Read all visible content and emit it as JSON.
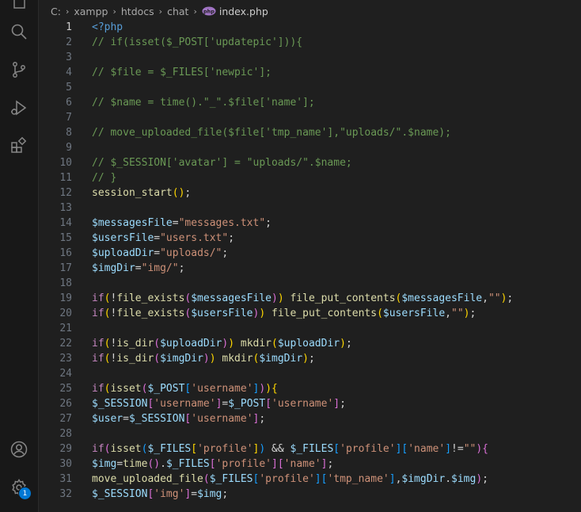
{
  "breadcrumb": {
    "items": [
      "C:",
      "xampp",
      "htdocs",
      "chat"
    ],
    "file": "index.php"
  },
  "activity": {
    "icons": [
      "files-icon",
      "search-icon",
      "source-control-icon",
      "run-debug-icon",
      "extensions-icon",
      "account-icon",
      "settings-gear-icon"
    ],
    "settings_badge": "1"
  },
  "colors": {
    "background": "#1f1f1f",
    "activity_bar": "#181818",
    "comment": "#6a9955",
    "keyword_tag": "#569cd6",
    "function": "#dcdcaa",
    "variable": "#9cdcfe",
    "string": "#ce9178",
    "badge": "#0078d4"
  },
  "editor": {
    "active_line": 1,
    "lines": [
      {
        "n": "1",
        "code": [
          [
            "t-tag",
            "<?php"
          ]
        ]
      },
      {
        "n": "2",
        "code": [
          [
            "t-com",
            "// if(isset($_POST['updatepic'])){"
          ]
        ]
      },
      {
        "n": "3",
        "code": []
      },
      {
        "n": "4",
        "code": [
          [
            "t-com",
            "// $file = $_FILES['newpic'];"
          ]
        ]
      },
      {
        "n": "5",
        "code": []
      },
      {
        "n": "6",
        "code": [
          [
            "t-com",
            "// $name = time().\"_\".$file['name'];"
          ]
        ]
      },
      {
        "n": "7",
        "code": []
      },
      {
        "n": "8",
        "code": [
          [
            "t-com",
            "// move_uploaded_file($file['tmp_name'],\"uploads/\".$name);"
          ]
        ]
      },
      {
        "n": "9",
        "code": []
      },
      {
        "n": "10",
        "code": [
          [
            "t-com",
            "// $_SESSION['avatar'] = \"uploads/\".$name;"
          ]
        ]
      },
      {
        "n": "11",
        "code": [
          [
            "t-com",
            "// }"
          ]
        ]
      },
      {
        "n": "12",
        "code": [
          [
            "t-fn",
            "session_start"
          ],
          [
            "t-p1",
            "()"
          ],
          [
            "t-op",
            ";"
          ]
        ]
      },
      {
        "n": "13",
        "code": []
      },
      {
        "n": "14",
        "code": [
          [
            "t-var",
            "$messagesFile"
          ],
          [
            "t-op",
            "="
          ],
          [
            "t-str",
            "\"messages.txt\""
          ],
          [
            "t-op",
            ";"
          ]
        ]
      },
      {
        "n": "15",
        "code": [
          [
            "t-var",
            "$usersFile"
          ],
          [
            "t-op",
            "="
          ],
          [
            "t-str",
            "\"users.txt\""
          ],
          [
            "t-op",
            ";"
          ]
        ]
      },
      {
        "n": "16",
        "code": [
          [
            "t-var",
            "$uploadDir"
          ],
          [
            "t-op",
            "="
          ],
          [
            "t-str",
            "\"uploads/\""
          ],
          [
            "t-op",
            ";"
          ]
        ]
      },
      {
        "n": "17",
        "code": [
          [
            "t-var",
            "$imgDir"
          ],
          [
            "t-op",
            "="
          ],
          [
            "t-str",
            "\"img/\""
          ],
          [
            "t-op",
            ";"
          ]
        ]
      },
      {
        "n": "18",
        "code": []
      },
      {
        "n": "19",
        "code": [
          [
            "t-kw",
            "if"
          ],
          [
            "t-p1",
            "("
          ],
          [
            "t-op",
            "!"
          ],
          [
            "t-fn",
            "file_exists"
          ],
          [
            "t-p2",
            "("
          ],
          [
            "t-var",
            "$messagesFile"
          ],
          [
            "t-p2",
            ")"
          ],
          [
            "t-p1",
            ")"
          ],
          [
            "t-op",
            " "
          ],
          [
            "t-fn",
            "file_put_contents"
          ],
          [
            "t-p1",
            "("
          ],
          [
            "t-var",
            "$messagesFile"
          ],
          [
            "t-op",
            ","
          ],
          [
            "t-str",
            "\"\""
          ],
          [
            "t-p1",
            ")"
          ],
          [
            "t-op",
            ";"
          ]
        ]
      },
      {
        "n": "20",
        "code": [
          [
            "t-kw",
            "if"
          ],
          [
            "t-p1",
            "("
          ],
          [
            "t-op",
            "!"
          ],
          [
            "t-fn",
            "file_exists"
          ],
          [
            "t-p2",
            "("
          ],
          [
            "t-var",
            "$usersFile"
          ],
          [
            "t-p2",
            ")"
          ],
          [
            "t-p1",
            ")"
          ],
          [
            "t-op",
            " "
          ],
          [
            "t-fn",
            "file_put_contents"
          ],
          [
            "t-p1",
            "("
          ],
          [
            "t-var",
            "$usersFile"
          ],
          [
            "t-op",
            ","
          ],
          [
            "t-str",
            "\"\""
          ],
          [
            "t-p1",
            ")"
          ],
          [
            "t-op",
            ";"
          ]
        ]
      },
      {
        "n": "21",
        "code": []
      },
      {
        "n": "22",
        "code": [
          [
            "t-kw",
            "if"
          ],
          [
            "t-p1",
            "("
          ],
          [
            "t-op",
            "!"
          ],
          [
            "t-fn",
            "is_dir"
          ],
          [
            "t-p2",
            "("
          ],
          [
            "t-var",
            "$uploadDir"
          ],
          [
            "t-p2",
            ")"
          ],
          [
            "t-p1",
            ")"
          ],
          [
            "t-op",
            " "
          ],
          [
            "t-fn",
            "mkdir"
          ],
          [
            "t-p1",
            "("
          ],
          [
            "t-var",
            "$uploadDir"
          ],
          [
            "t-p1",
            ")"
          ],
          [
            "t-op",
            ";"
          ]
        ]
      },
      {
        "n": "23",
        "code": [
          [
            "t-kw",
            "if"
          ],
          [
            "t-p1",
            "("
          ],
          [
            "t-op",
            "!"
          ],
          [
            "t-fn",
            "is_dir"
          ],
          [
            "t-p2",
            "("
          ],
          [
            "t-var",
            "$imgDir"
          ],
          [
            "t-p2",
            ")"
          ],
          [
            "t-p1",
            ")"
          ],
          [
            "t-op",
            " "
          ],
          [
            "t-fn",
            "mkdir"
          ],
          [
            "t-p1",
            "("
          ],
          [
            "t-var",
            "$imgDir"
          ],
          [
            "t-p1",
            ")"
          ],
          [
            "t-op",
            ";"
          ]
        ]
      },
      {
        "n": "24",
        "code": []
      },
      {
        "n": "25",
        "code": [
          [
            "t-kw",
            "if"
          ],
          [
            "t-p1",
            "("
          ],
          [
            "t-fn",
            "isset"
          ],
          [
            "t-p2",
            "("
          ],
          [
            "t-var",
            "$_POST"
          ],
          [
            "t-p3",
            "["
          ],
          [
            "t-str",
            "'username'"
          ],
          [
            "t-p3",
            "]"
          ],
          [
            "t-p2",
            ")"
          ],
          [
            "t-p1",
            ")"
          ],
          [
            "t-p1",
            "{"
          ]
        ]
      },
      {
        "n": "26",
        "code": [
          [
            "t-var",
            "$_SESSION"
          ],
          [
            "t-p2",
            "["
          ],
          [
            "t-str",
            "'username'"
          ],
          [
            "t-p2",
            "]"
          ],
          [
            "t-op",
            "="
          ],
          [
            "t-var",
            "$_POST"
          ],
          [
            "t-p2",
            "["
          ],
          [
            "t-str",
            "'username'"
          ],
          [
            "t-p2",
            "]"
          ],
          [
            "t-op",
            ";"
          ]
        ]
      },
      {
        "n": "27",
        "code": [
          [
            "t-var",
            "$user"
          ],
          [
            "t-op",
            "="
          ],
          [
            "t-var",
            "$_SESSION"
          ],
          [
            "t-p2",
            "["
          ],
          [
            "t-str",
            "'username'"
          ],
          [
            "t-p2",
            "]"
          ],
          [
            "t-op",
            ";"
          ]
        ]
      },
      {
        "n": "28",
        "code": []
      },
      {
        "n": "29",
        "code": [
          [
            "t-kw",
            "if"
          ],
          [
            "t-p2",
            "("
          ],
          [
            "t-fn",
            "isset"
          ],
          [
            "t-p3",
            "("
          ],
          [
            "t-var",
            "$_FILES"
          ],
          [
            "t-p1",
            "["
          ],
          [
            "t-str",
            "'profile'"
          ],
          [
            "t-p1",
            "]"
          ],
          [
            "t-p3",
            ")"
          ],
          [
            "t-op",
            " && "
          ],
          [
            "t-var",
            "$_FILES"
          ],
          [
            "t-p3",
            "["
          ],
          [
            "t-str",
            "'profile'"
          ],
          [
            "t-p3",
            "]"
          ],
          [
            "t-p3",
            "["
          ],
          [
            "t-str",
            "'name'"
          ],
          [
            "t-p3",
            "]"
          ],
          [
            "t-op",
            "!="
          ],
          [
            "t-str",
            "\"\""
          ],
          [
            "t-p2",
            ")"
          ],
          [
            "t-p2",
            "{"
          ]
        ]
      },
      {
        "n": "30",
        "code": [
          [
            "t-var",
            "$img"
          ],
          [
            "t-op",
            "="
          ],
          [
            "t-fn",
            "time"
          ],
          [
            "t-p2",
            "()"
          ],
          [
            "t-op",
            "."
          ],
          [
            "t-var",
            "$_FILES"
          ],
          [
            "t-p2",
            "["
          ],
          [
            "t-str",
            "'profile'"
          ],
          [
            "t-p2",
            "]"
          ],
          [
            "t-p2",
            "["
          ],
          [
            "t-str",
            "'name'"
          ],
          [
            "t-p2",
            "]"
          ],
          [
            "t-op",
            ";"
          ]
        ]
      },
      {
        "n": "31",
        "code": [
          [
            "t-fn",
            "move_uploaded_file"
          ],
          [
            "t-p2",
            "("
          ],
          [
            "t-var",
            "$_FILES"
          ],
          [
            "t-p3",
            "["
          ],
          [
            "t-str",
            "'profile'"
          ],
          [
            "t-p3",
            "]"
          ],
          [
            "t-p3",
            "["
          ],
          [
            "t-str",
            "'tmp_name'"
          ],
          [
            "t-p3",
            "]"
          ],
          [
            "t-op",
            ","
          ],
          [
            "t-var",
            "$imgDir"
          ],
          [
            "t-op",
            "."
          ],
          [
            "t-var",
            "$img"
          ],
          [
            "t-p2",
            ")"
          ],
          [
            "t-op",
            ";"
          ]
        ]
      },
      {
        "n": "32",
        "code": [
          [
            "t-var",
            "$_SESSION"
          ],
          [
            "t-p2",
            "["
          ],
          [
            "t-str",
            "'img'"
          ],
          [
            "t-p2",
            "]"
          ],
          [
            "t-op",
            "="
          ],
          [
            "t-var",
            "$img"
          ],
          [
            "t-op",
            ";"
          ]
        ]
      }
    ]
  }
}
